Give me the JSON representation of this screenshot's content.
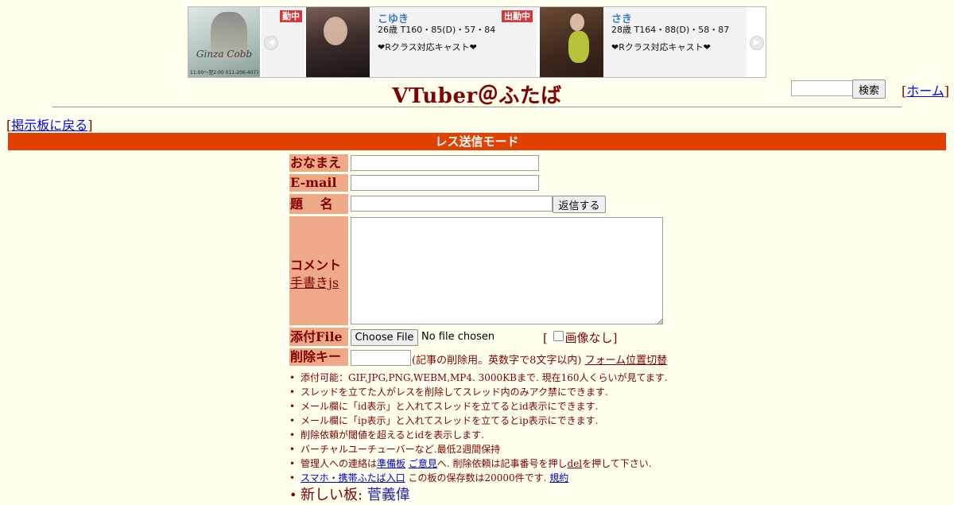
{
  "ad": {
    "shop_name": "Ginza Cobb",
    "shop_info": "11:00〜翌2:00 011-206-4077",
    "partial_status": "勤中",
    "casts": [
      {
        "name": "こゆき",
        "status": "出勤中",
        "stats": "26歳 T160・85(D)・57・84",
        "tag": "❤Rクラス対応キャスト❤"
      },
      {
        "name": "さき",
        "status": "",
        "stats": "28歳 T164・88(D)・58・87",
        "tag": "❤Rクラス対応キャスト❤"
      }
    ]
  },
  "header": {
    "title": "VTuber＠ふたば",
    "search_button": "検索",
    "home_link": "ホーム",
    "back_link": "掲示板に戻る"
  },
  "mode_banner": "レス送信モード",
  "form": {
    "name_label": "おなまえ",
    "email_label": "E-mail",
    "subject_label": "題　 名",
    "submit_button": "返信する",
    "comment_label": "コメント",
    "handwriting_link": "手書きjs",
    "file_label": "添付File",
    "choose_file_button": "Choose File",
    "file_status": "No file chosen",
    "no_image_label": "画像なし",
    "delete_key_label": "削除キー",
    "delete_key_note": "(記事の削除用。英数字で8文字以内)",
    "form_position_link": "フォーム位置切替"
  },
  "notes": [
    {
      "text": "添付可能：GIF,JPG,PNG,WEBM,MP4. 3000KBまで. 現在160人くらいが見てます."
    },
    {
      "text": "スレッドを立てた人がレスを削除してスレッド内のみアク禁にできます."
    },
    {
      "text": "メール欄に「id表示」と入れてスレッドを立てるとid表示にできます."
    },
    {
      "text": "メール欄に「ip表示」と入れてスレッドを立てるとip表示にできます."
    },
    {
      "text": "削除依頼が閾値を超えるとidを表示します."
    },
    {
      "text": "バーチャルユーチューバーなど.最低2週間保持"
    }
  ],
  "contact_note": {
    "prefix": "管理人への連絡は",
    "link1": "準備板",
    "link2": "ご意見",
    "middle": "へ. 削除依頼は記事番号を押し",
    "link3": "del",
    "suffix": "を押して下さい."
  },
  "mobile_note": {
    "link": "スマホ・携帯ふたば入口",
    "text": " この板の保存数は20000件です. ",
    "rules_link": "規約"
  },
  "new_board": {
    "label": "新しい板:",
    "link": "菅義偉"
  }
}
